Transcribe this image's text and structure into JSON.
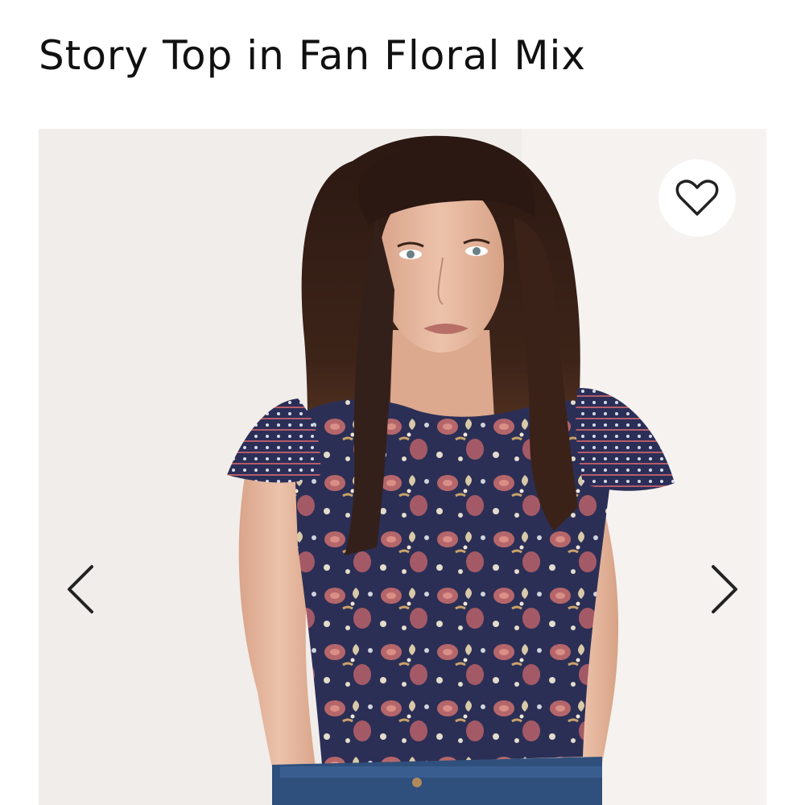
{
  "product": {
    "title": "Story Top in Fan Floral Mix"
  },
  "gallery": {
    "favorite_icon": "heart-outline-icon",
    "prev_icon": "chevron-left-icon",
    "next_icon": "chevron-right-icon"
  },
  "colors": {
    "title_text": "#111111",
    "icon_stroke": "#222222",
    "background": "#ffffff",
    "photo_backdrop": "#f3f0ee"
  }
}
